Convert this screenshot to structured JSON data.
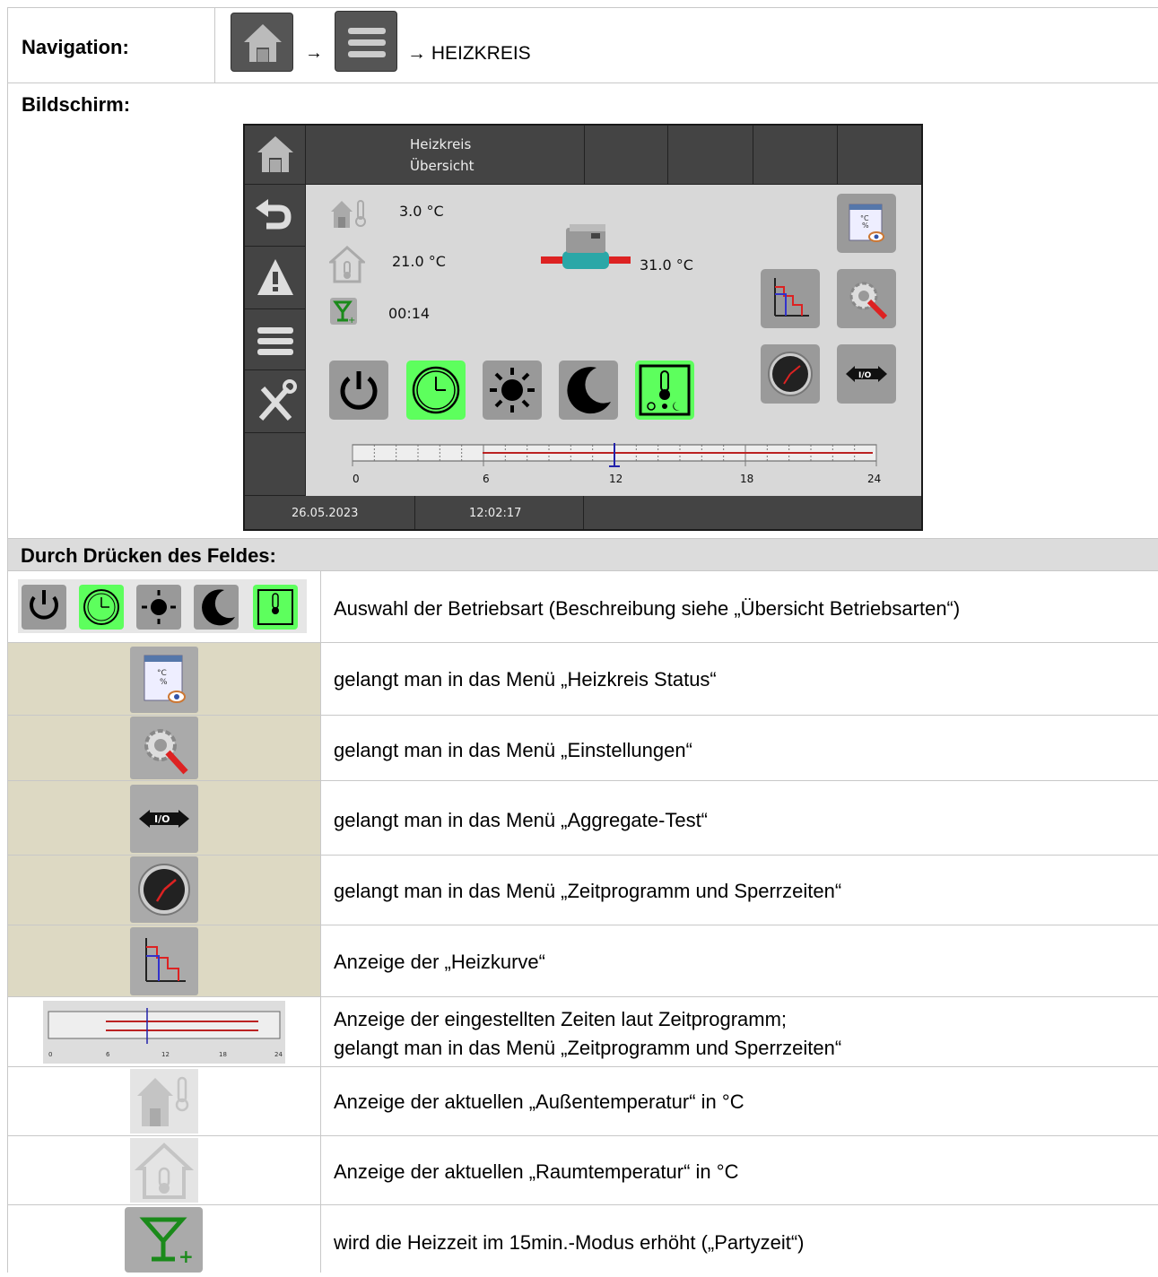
{
  "navigation": {
    "label": "Navigation:",
    "home_icon": "home-icon",
    "arrow1": "→",
    "menu_icon": "menu-icon",
    "arrow_target": "→ HEIZKREIS"
  },
  "screen_section": {
    "label": "Bildschirm:"
  },
  "device": {
    "header_title_line1": "Heizkreis",
    "header_title_line2": "Übersicht",
    "outdoor_temp": "3.0  °C",
    "room_temp": "21.0  °C",
    "party_time": "00:14",
    "flow_temp": "31.0 °C",
    "timeline_ticks": [
      "0",
      "6",
      "12",
      "18",
      "24"
    ],
    "status_date": "26.05.2023",
    "status_time": "12:02:17",
    "modes": [
      {
        "icon": "power-icon",
        "active": false
      },
      {
        "icon": "clock-icon",
        "active": true
      },
      {
        "icon": "sun-icon",
        "active": false
      },
      {
        "icon": "moon-icon",
        "active": false
      },
      {
        "icon": "thermometer-auto-icon",
        "active": true
      }
    ]
  },
  "press_section": {
    "label": "Durch Drücken des Feldes:",
    "rows": [
      {
        "icon": "mode-buttons-strip",
        "text": "Auswahl der Betriebsart (Beschreibung siehe „Übersicht Betriebsarten“)"
      },
      {
        "icon": "status-icon",
        "text": "gelangt man in das Menü „Heizkreis Status“"
      },
      {
        "icon": "settings-icon",
        "text": "gelangt man in das Menü „Einstellungen“"
      },
      {
        "icon": "io-test-icon",
        "text": "gelangt man in das Menü „Aggregate-Test“"
      },
      {
        "icon": "clock-dial-icon",
        "text": "gelangt man in das Menü „Zeitprogramm und Sperrzeiten“"
      },
      {
        "icon": "heating-curve-icon",
        "text": "Anzeige der „Heizkurve“"
      },
      {
        "icon": "timeline-icon",
        "text_line1": "Anzeige der eingestellten Zeiten laut Zeitprogramm;",
        "text_line2": "gelangt man in das Menü „Zeitprogramm und Sperrzeiten“"
      },
      {
        "icon": "outdoor-temp-icon",
        "text": "Anzeige der aktuellen „Außentemperatur“ in °C"
      },
      {
        "icon": "room-temp-icon",
        "text": "Anzeige der aktuellen „Raumtemperatur“ in °C"
      },
      {
        "icon": "party-icon",
        "text": "wird die Heizzeit im 15min.-Modus erhöht („Partyzeit“)"
      }
    ]
  },
  "colors": {
    "beige": "#ddd9c3",
    "active_green": "#5dff5d",
    "device_dark": "#444444",
    "section_grey": "#dcdcdc"
  }
}
